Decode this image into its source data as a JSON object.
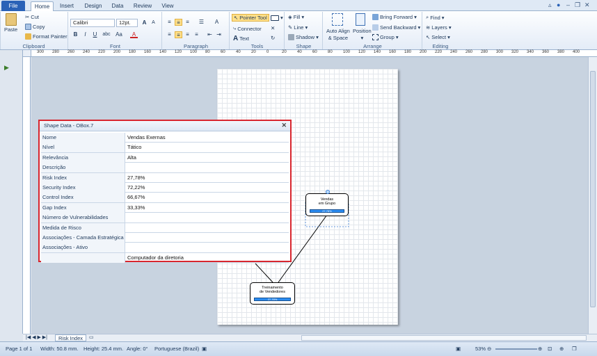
{
  "tabs": [
    "File",
    "Home",
    "Insert",
    "Design",
    "Data",
    "Review",
    "View"
  ],
  "active_tab": "Home",
  "clipboard": {
    "paste": "Paste",
    "cut": "Cut",
    "copy": "Copy",
    "format_painter": "Format Painter",
    "label": "Clipboard"
  },
  "font": {
    "name": "Calibri",
    "size": "12pt.",
    "label": "Font"
  },
  "paragraph": {
    "label": "Paragraph"
  },
  "tools": {
    "pointer": "Pointer Tool",
    "connector": "Connector",
    "text": "Text",
    "label": "Tools"
  },
  "shape": {
    "fill": "Fill",
    "line": "Line",
    "shadow": "Shadow",
    "label": "Shape"
  },
  "arrange": {
    "auto_align": "Auto Align",
    "space": "& Space",
    "position": "Position",
    "bring_forward": "Bring Forward",
    "send_backward": "Send Backward",
    "group": "Group",
    "label": "Arrange"
  },
  "editing": {
    "find": "Find",
    "layers": "Layers",
    "select": "Select",
    "label": "Editing"
  },
  "ruler_ticks": [
    "300",
    "280",
    "260",
    "240",
    "220",
    "200",
    "180",
    "160",
    "140",
    "120",
    "100",
    "80",
    "60",
    "40",
    "20",
    "0",
    "20",
    "40",
    "60",
    "80",
    "100",
    "120",
    "140",
    "160",
    "180",
    "200",
    "220",
    "240",
    "260",
    "280",
    "300",
    "320",
    "340",
    "360",
    "380",
    "400"
  ],
  "dialog": {
    "title": "Shape Data - OBox.7",
    "close": "✕",
    "rows": [
      {
        "key": "Nome",
        "value": "Vendas Exernas"
      },
      {
        "key": "Nível",
        "value": "Tático"
      },
      {
        "key": "Relevância",
        "value": "Alta"
      },
      {
        "key": "Descrição",
        "value": ""
      },
      {
        "key": "Risk Index",
        "value": "27,78%"
      },
      {
        "key": "Security Index",
        "value": "72,22%"
      },
      {
        "key": "Control Index",
        "value": "66,67%"
      },
      {
        "key": "Gap Index",
        "value": "33,33%"
      },
      {
        "key": "Número de Vulnerabilidades",
        "value": ""
      },
      {
        "key": "Medida de Risco",
        "value": ""
      },
      {
        "key": "Associações - Camada Estratégica",
        "value": ""
      },
      {
        "key": "Associações - Ativo",
        "value": ""
      },
      {
        "key": "",
        "value": "Computador  da diretoria"
      }
    ]
  },
  "nodes": {
    "top": {
      "line1": "Vendas",
      "line2": "em Grupo",
      "bar": "27,78%"
    },
    "bottom": {
      "line1": "Treinamento",
      "line2": "de Vendedores",
      "bar": "27,78%"
    }
  },
  "sheet_tab": "Risk Index",
  "status": {
    "page": "Page 1 of 1",
    "width": "Width: 50.8 mm.",
    "height": "Height: 25.4 mm.",
    "angle": "Angle: 0°",
    "language": "Portuguese (Brazil)",
    "zoom": "53%"
  }
}
